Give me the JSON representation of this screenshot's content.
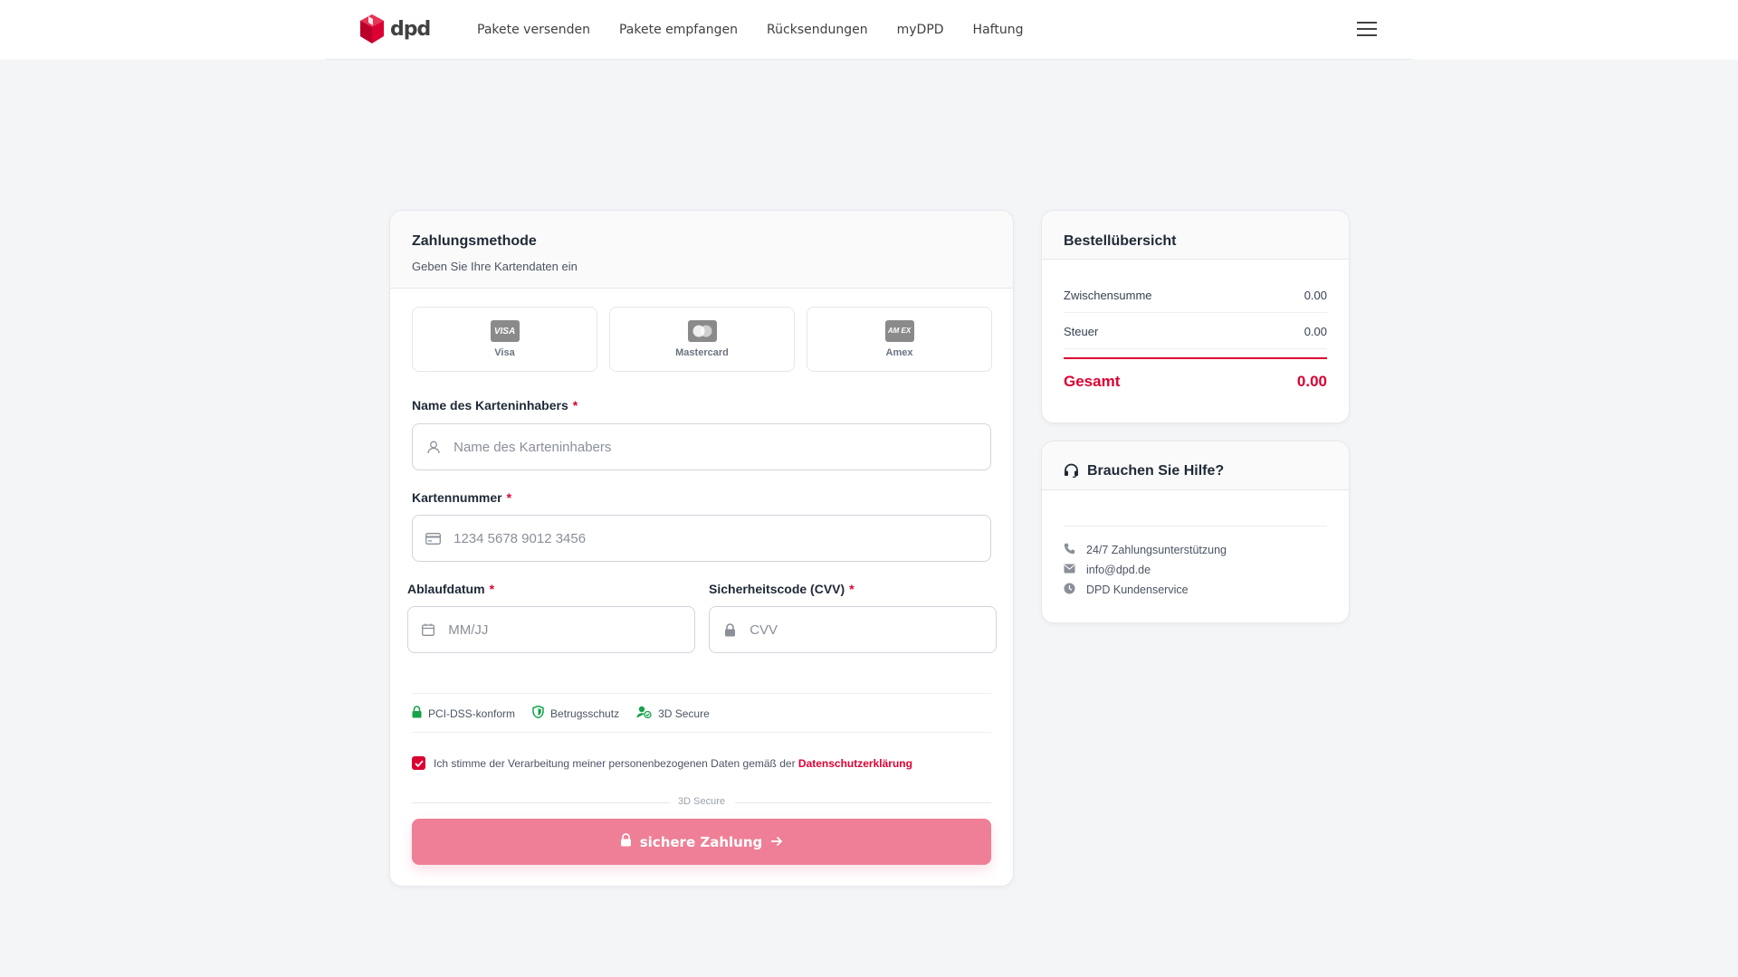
{
  "brand": {
    "name": "dpd",
    "accent": "#dc0032"
  },
  "nav": {
    "items": [
      {
        "label": "Pakete versenden"
      },
      {
        "label": "Pakete empfangen"
      },
      {
        "label": "Rücksendungen"
      },
      {
        "label": "myDPD"
      },
      {
        "label": "Haftung"
      }
    ],
    "menu_icon": "hamburger-menu-icon"
  },
  "payment": {
    "title": "Zahlungsmethode",
    "subtitle": "Geben Sie Ihre Kartendaten ein",
    "methods": [
      {
        "name": "Visa",
        "logo": "VISA"
      },
      {
        "name": "Mastercard",
        "logo": ""
      },
      {
        "name": "Amex",
        "logo": "AM EX"
      }
    ],
    "cardholder": {
      "label": "Name des Karteninhabers",
      "placeholder": "Name des Karteninhabers",
      "value": ""
    },
    "card_number": {
      "label": "Kartennummer",
      "placeholder": "1234 5678 9012 3456",
      "value": ""
    },
    "expiry": {
      "label": "Ablaufdatum",
      "placeholder": "MM/JJ",
      "value": ""
    },
    "cvv": {
      "label": "Sicherheitscode (CVV)",
      "placeholder": "CVV",
      "value": ""
    },
    "required_mark": "*",
    "badges": [
      {
        "label": "PCI-DSS-konform",
        "icon": "lock-icon"
      },
      {
        "label": "Betrugsschutz",
        "icon": "shield-icon"
      },
      {
        "label": "3D Secure",
        "icon": "user-check-icon"
      }
    ],
    "consent": {
      "text": "Ich stimme der Verarbeitung meiner personenbezogenen Daten gemäß der",
      "link": "Datenschutzerklärung",
      "checked": true
    },
    "secure_label": "3D Secure",
    "submit_label": "sichere Zahlung"
  },
  "summary": {
    "title": "Bestellübersicht",
    "subtotal_label": "Zwischensumme",
    "subtotal_value": "0.00",
    "tax_label": "Steuer",
    "tax_value": "0.00",
    "total_label": "Gesamt",
    "total_value": "0.00"
  },
  "help": {
    "title": "Brauchen Sie Hilfe?",
    "items": [
      {
        "label": "24/7 Zahlungsunterstützung",
        "icon": "phone-icon"
      },
      {
        "label": "info@dpd.de",
        "icon": "mail-icon"
      },
      {
        "label": "DPD Kundenservice",
        "icon": "clock-icon"
      }
    ]
  }
}
